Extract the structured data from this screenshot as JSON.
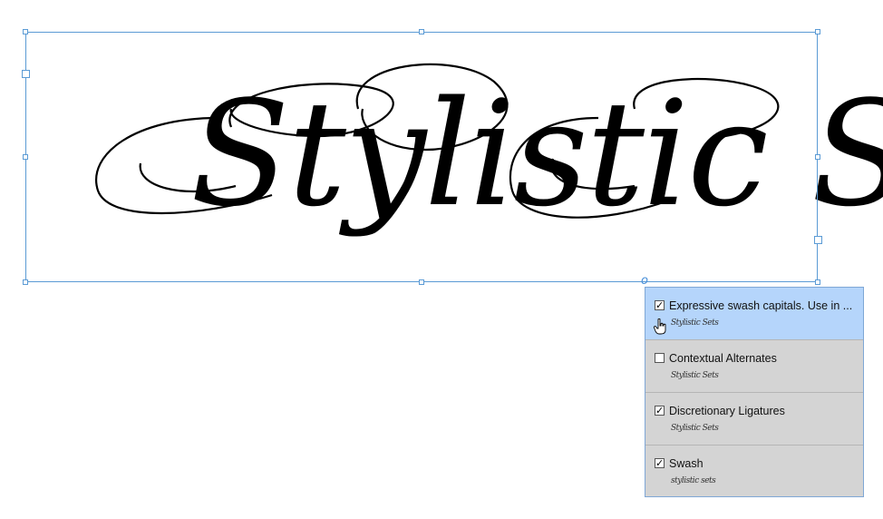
{
  "artwork": {
    "text": "Stylistic Sets",
    "color": "#000000"
  },
  "selection": {
    "color": "#5b9bd5",
    "anchor_glyph": "o"
  },
  "panel": {
    "items": [
      {
        "label": "Expressive swash capitals. Use in ...",
        "checked": true,
        "selected": true,
        "preview": "Stylistic Sets"
      },
      {
        "label": "Contextual Alternates",
        "checked": false,
        "selected": false,
        "preview": "Stylistic Sets"
      },
      {
        "label": "Discretionary Ligatures",
        "checked": true,
        "selected": false,
        "preview": "Stylistic Sets"
      },
      {
        "label": "Swash",
        "checked": true,
        "selected": false,
        "preview": "stylistic sets"
      }
    ],
    "check_glyph": "✓",
    "cursor_icon": "hand-pointer-icon"
  }
}
